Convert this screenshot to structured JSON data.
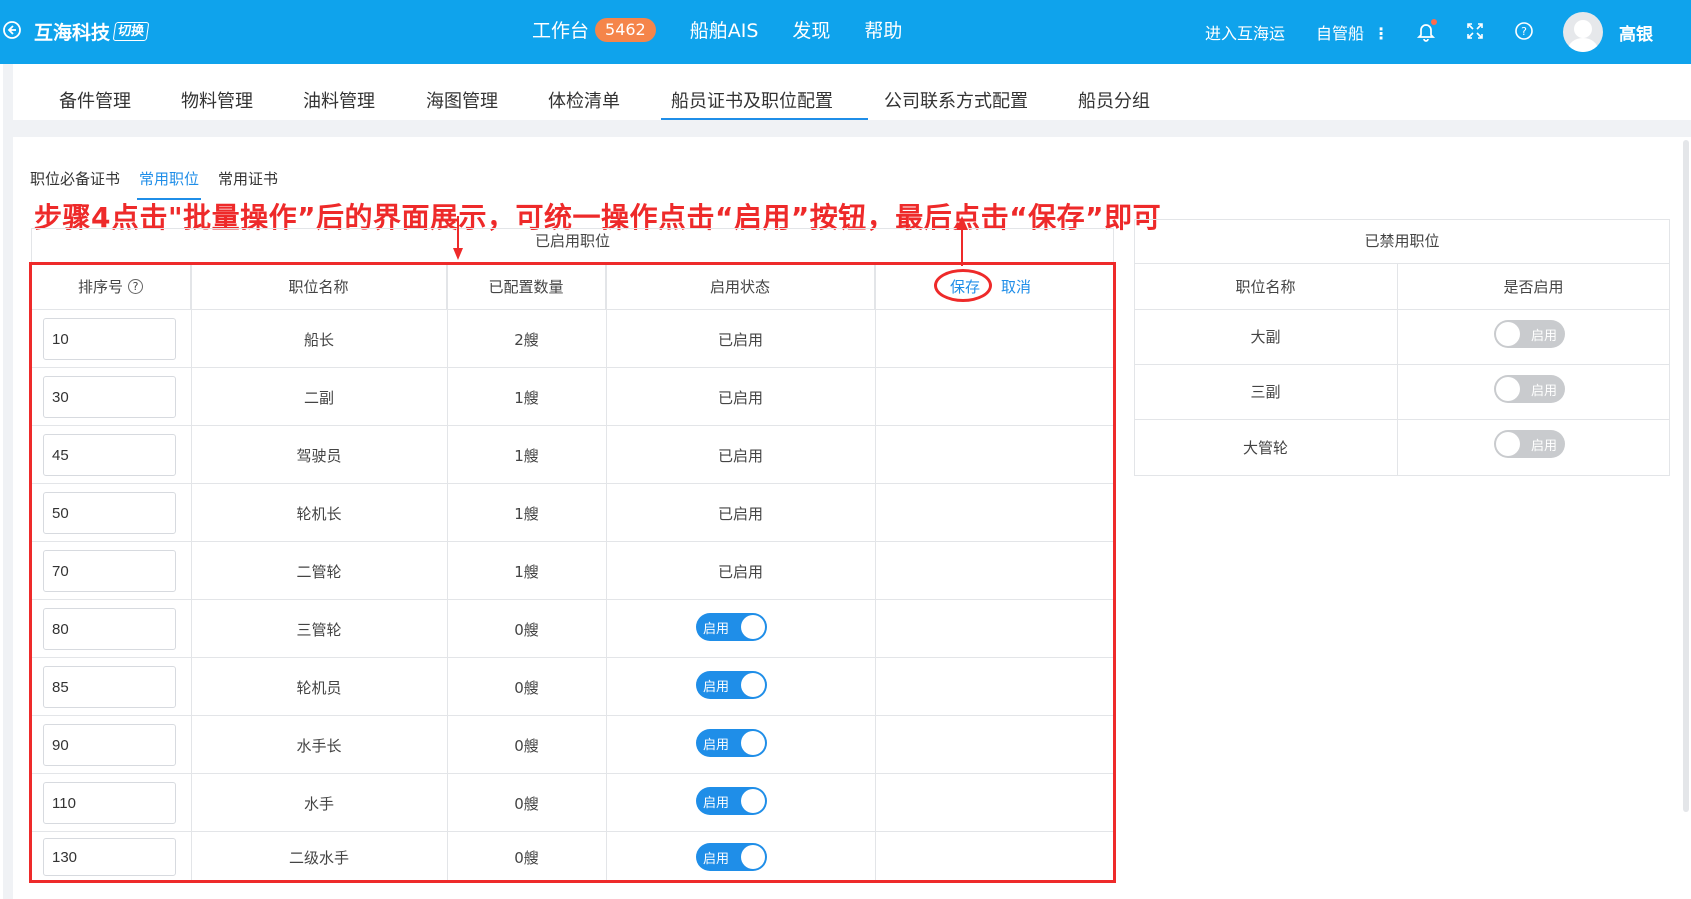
{
  "header": {
    "brand": "互海科技",
    "switch_label": "切换",
    "nav": [
      {
        "label": "工作台",
        "badge": "5462"
      },
      {
        "label": "船舶AIS"
      },
      {
        "label": "发现"
      },
      {
        "label": "帮助"
      }
    ],
    "enter_link": "进入互海运",
    "ship_mode": "自管船",
    "username": "高银",
    "colors": {
      "bar": "#0fa3ec",
      "badge": "#f5854a"
    }
  },
  "tabs": [
    "备件管理",
    "物料管理",
    "油料管理",
    "海图管理",
    "体检清单",
    "船员证书及职位配置",
    "公司联系方式配置",
    "船员分组"
  ],
  "active_tab": "船员证书及职位配置",
  "subtabs": [
    "职位必备证书",
    "常用职位",
    "常用证书"
  ],
  "active_subtab": "常用职位",
  "annotation": "步骤4点击\"批量操作”后的界面展示，可统一操作点击“启用”按钮，最后点击“保存”即可",
  "enabled_table": {
    "title": "已启用职位",
    "headers": {
      "sort": "排序号",
      "name": "职位名称",
      "count": "已配置数量",
      "status": "启用状态"
    },
    "save_label": "保存",
    "cancel_label": "取消",
    "rows": [
      {
        "sort": "10",
        "name": "船长",
        "count": "2艘",
        "status": "已启用",
        "toggle": false
      },
      {
        "sort": "30",
        "name": "二副",
        "count": "1艘",
        "status": "已启用",
        "toggle": false
      },
      {
        "sort": "45",
        "name": "驾驶员",
        "count": "1艘",
        "status": "已启用",
        "toggle": false
      },
      {
        "sort": "50",
        "name": "轮机长",
        "count": "1艘",
        "status": "已启用",
        "toggle": false
      },
      {
        "sort": "70",
        "name": "二管轮",
        "count": "1艘",
        "status": "已启用",
        "toggle": false
      },
      {
        "sort": "80",
        "name": "三管轮",
        "count": "0艘",
        "status": "启用",
        "toggle": true
      },
      {
        "sort": "85",
        "name": "轮机员",
        "count": "0艘",
        "status": "启用",
        "toggle": true
      },
      {
        "sort": "90",
        "name": "水手长",
        "count": "0艘",
        "status": "启用",
        "toggle": true
      },
      {
        "sort": "110",
        "name": "水手",
        "count": "0艘",
        "status": "启用",
        "toggle": true
      },
      {
        "sort": "130",
        "name": "二级水手",
        "count": "0艘",
        "status": "启用",
        "toggle": true
      }
    ]
  },
  "disabled_table": {
    "title": "已禁用职位",
    "headers": {
      "name": "职位名称",
      "enabled": "是否启用"
    },
    "rows": [
      {
        "name": "大副",
        "toggle_label": "启用"
      },
      {
        "name": "三副",
        "toggle_label": "启用"
      },
      {
        "name": "大管轮",
        "toggle_label": "启用"
      }
    ]
  }
}
